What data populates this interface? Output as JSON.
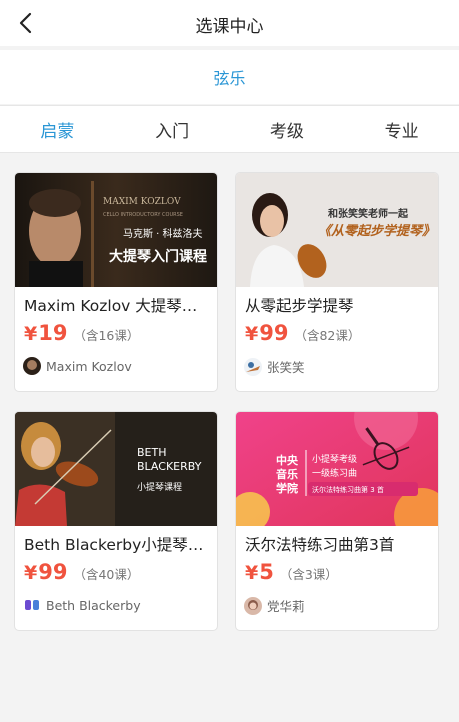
{
  "nav": {
    "title": "选课中心"
  },
  "category": {
    "label": "弦乐"
  },
  "levels": [
    "启蒙",
    "入门",
    "考级",
    "专业"
  ],
  "active_level": "启蒙",
  "colors": {
    "accent": "#2a96d5",
    "price": "#f0533e"
  },
  "courses": [
    {
      "title": "Maxim Kozlov 大提琴入门课程",
      "currency": "¥",
      "price": "19",
      "lessons": "（含16课）",
      "teacher": "Maxim Kozlov",
      "cover": {
        "line1": "MAXIM KOZLOV",
        "line2": "CELLO INTRODUCTORY COURSE",
        "line3": "马克斯 · 科兹洛夫",
        "line4": "大提琴入门课程"
      }
    },
    {
      "title": "从零起步学提琴",
      "currency": "¥",
      "price": "99",
      "lessons": "（含82课）",
      "teacher": "张笑笑",
      "cover": {
        "line1": "和张笑笑老师一起",
        "line2": "《从零起步学提琴》"
      }
    },
    {
      "title": "Beth Blackerby小提琴入门课程",
      "currency": "¥",
      "price": "99",
      "lessons": "（含40课）",
      "teacher": "Beth Blackerby",
      "cover": {
        "line1": "BETH",
        "line2": "BLACKERBY",
        "line3": "小提琴课程"
      }
    },
    {
      "title": "沃尔法特练习曲第3首",
      "currency": "¥",
      "price": "5",
      "lessons": "（含3课）",
      "teacher": "党华莉",
      "cover": {
        "line1": "中央",
        "line2": "音乐",
        "line3": "学院",
        "line4": "小提琴考级",
        "line5": "一级练习曲",
        "line6": "沃尔法特练习曲第 3 首"
      }
    }
  ]
}
